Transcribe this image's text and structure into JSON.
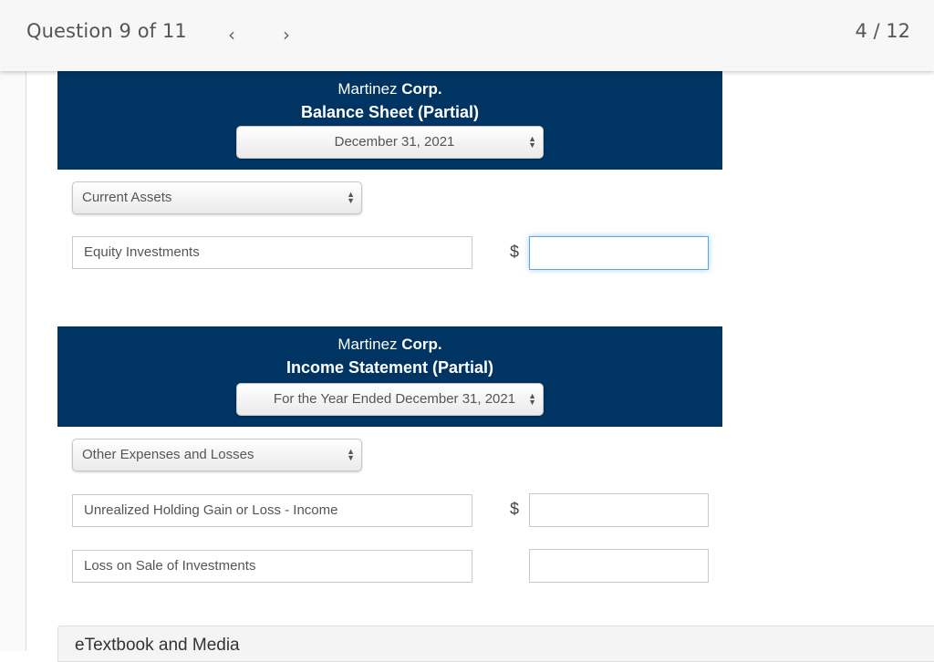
{
  "header": {
    "question_label": "Question 9 of 11",
    "prev_icon": "‹",
    "next_icon": "›",
    "page_count": "4 / 12"
  },
  "balance_sheet": {
    "company_regular": "Martinez ",
    "company_bold": "Corp.",
    "title": "Balance Sheet (Partial)",
    "date_select": "December 31, 2021",
    "section_select": "Current Assets",
    "rows": [
      {
        "account": "Equity Investments",
        "currency_symbol": "$",
        "amount": ""
      }
    ]
  },
  "income_statement": {
    "company_regular": "Martinez ",
    "company_bold": "Corp.",
    "title": "Income Statement (Partial)",
    "date_select": "For the Year Ended December 31, 2021",
    "section_select": "Other Expenses and Losses",
    "rows": [
      {
        "account": "Unrealized Holding Gain or Loss - Income",
        "currency_symbol": "$",
        "amount": ""
      },
      {
        "account": "Loss on Sale of Investments",
        "currency_symbol": "",
        "amount": ""
      }
    ]
  },
  "footer": {
    "etextbook_label": "eTextbook and Media"
  },
  "colors": {
    "header_navy": "#003462",
    "focus_blue": "#5aa6e3"
  }
}
